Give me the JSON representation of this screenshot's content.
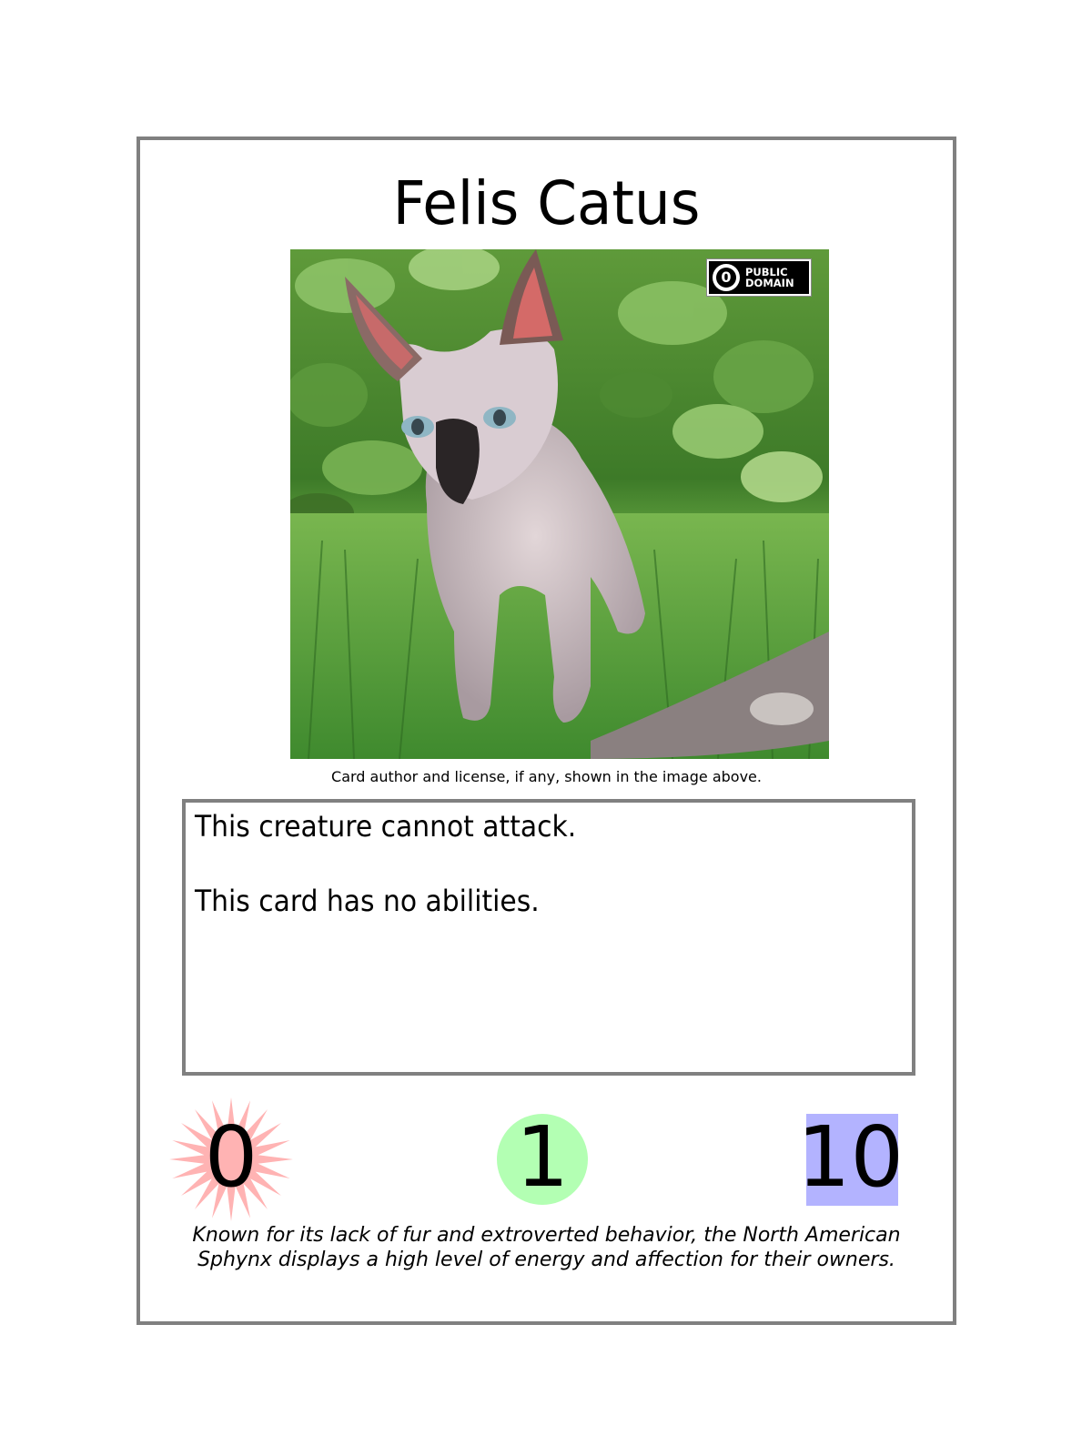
{
  "card": {
    "title": "Felis Catus",
    "art": {
      "subject": "cat-photo",
      "license_badge": {
        "symbol": "0",
        "text": "PUBLIC\nDOMAIN"
      }
    },
    "caption": "Card author and license, if any, shown in the image above.",
    "rules": [
      "This creature cannot attack.",
      "This card has no abilities."
    ],
    "stats": {
      "attack": {
        "value": "0",
        "icon": "starburst-icon",
        "color": "#ffb3b3"
      },
      "cost": {
        "value": "1",
        "icon": "circle-icon",
        "color": "#b3ffb3"
      },
      "health": {
        "value": "10",
        "icon": "square-icon",
        "color": "#b3b3ff"
      }
    },
    "flavor_text": "Known for its lack of fur and extroverted behavior, the North American\nSphynx displays a high level of energy and affection for their owners."
  },
  "colors": {
    "border": "#808080",
    "background": "#ffffff"
  }
}
